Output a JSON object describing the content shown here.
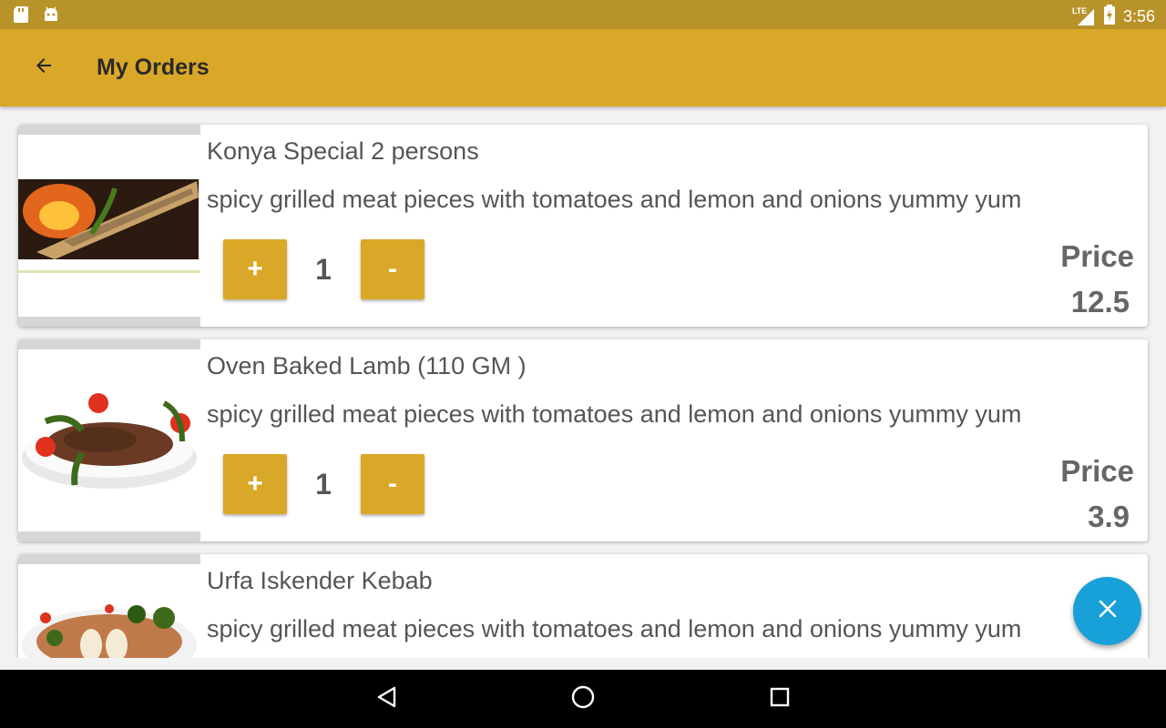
{
  "status_bar": {
    "time": "3:56",
    "network": "LTE",
    "icons": [
      "sd-card-icon",
      "android-icon",
      "lte-signal-icon",
      "battery-charging-icon"
    ]
  },
  "app_bar": {
    "title": "My Orders",
    "back_icon": "arrow-back-icon"
  },
  "orders": [
    {
      "name": "Konya Special 2 persons",
      "description": "spicy grilled meat pieces with tomatoes and lemon and onions yummy yum",
      "quantity": "1",
      "plus_label": "+",
      "minus_label": "-",
      "price_label": "Price",
      "price": "12.5"
    },
    {
      "name": "Oven Baked Lamb (110 GM )",
      "description": "spicy grilled meat pieces with tomatoes and lemon and onions yummy yum",
      "quantity": "1",
      "plus_label": "+",
      "minus_label": "-",
      "price_label": "Price",
      "price": "3.9"
    },
    {
      "name": "Urfa Iskender Kebab",
      "description": "spicy grilled meat pieces with tomatoes and lemon and onions yummy yum"
    }
  ],
  "fab": {
    "icon": "close-icon"
  },
  "nav_bar": {
    "icons": [
      "back-triangle-icon",
      "home-circle-icon",
      "recents-square-icon"
    ]
  },
  "colors": {
    "status_bar": "#b8932a",
    "app_bar": "#daa828",
    "button": "#daa828",
    "fab": "#18a0d8",
    "nav_bar": "#000000"
  }
}
